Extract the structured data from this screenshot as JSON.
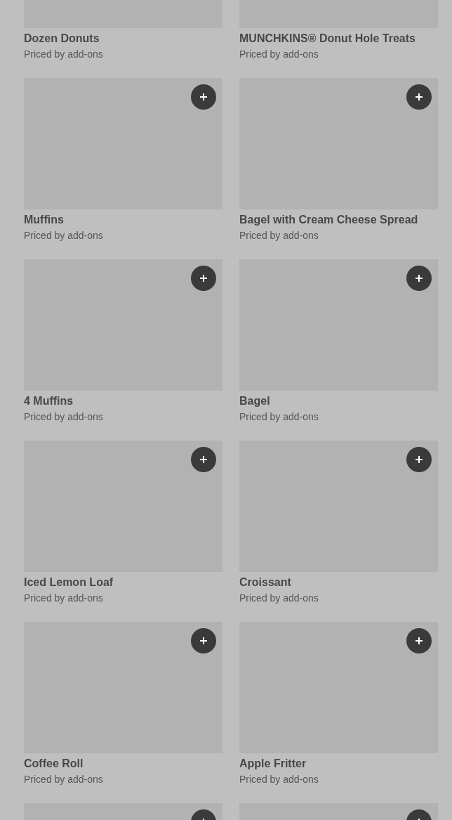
{
  "items": [
    {
      "title": "Dozen Donuts",
      "subtitle": "Priced by add-ons"
    },
    {
      "title": "MUNCHKINS® Donut Hole Treats",
      "subtitle": "Priced by add-ons"
    },
    {
      "title": "Muffins",
      "subtitle": "Priced by add-ons"
    },
    {
      "title": "Bagel with Cream Cheese Spread",
      "subtitle": "Priced by add-ons"
    },
    {
      "title": "4 Muffins",
      "subtitle": "Priced by add-ons"
    },
    {
      "title": "Bagel",
      "subtitle": "Priced by add-ons"
    },
    {
      "title": "Iced Lemon Loaf",
      "subtitle": "Priced by add-ons"
    },
    {
      "title": "Croissant",
      "subtitle": "Priced by add-ons"
    },
    {
      "title": "Coffee Roll",
      "subtitle": "Priced by add-ons"
    },
    {
      "title": "Apple Fritter",
      "subtitle": "Priced by add-ons"
    }
  ],
  "more_items": [
    {
      "kind": "card"
    },
    {
      "kind": "card"
    }
  ]
}
